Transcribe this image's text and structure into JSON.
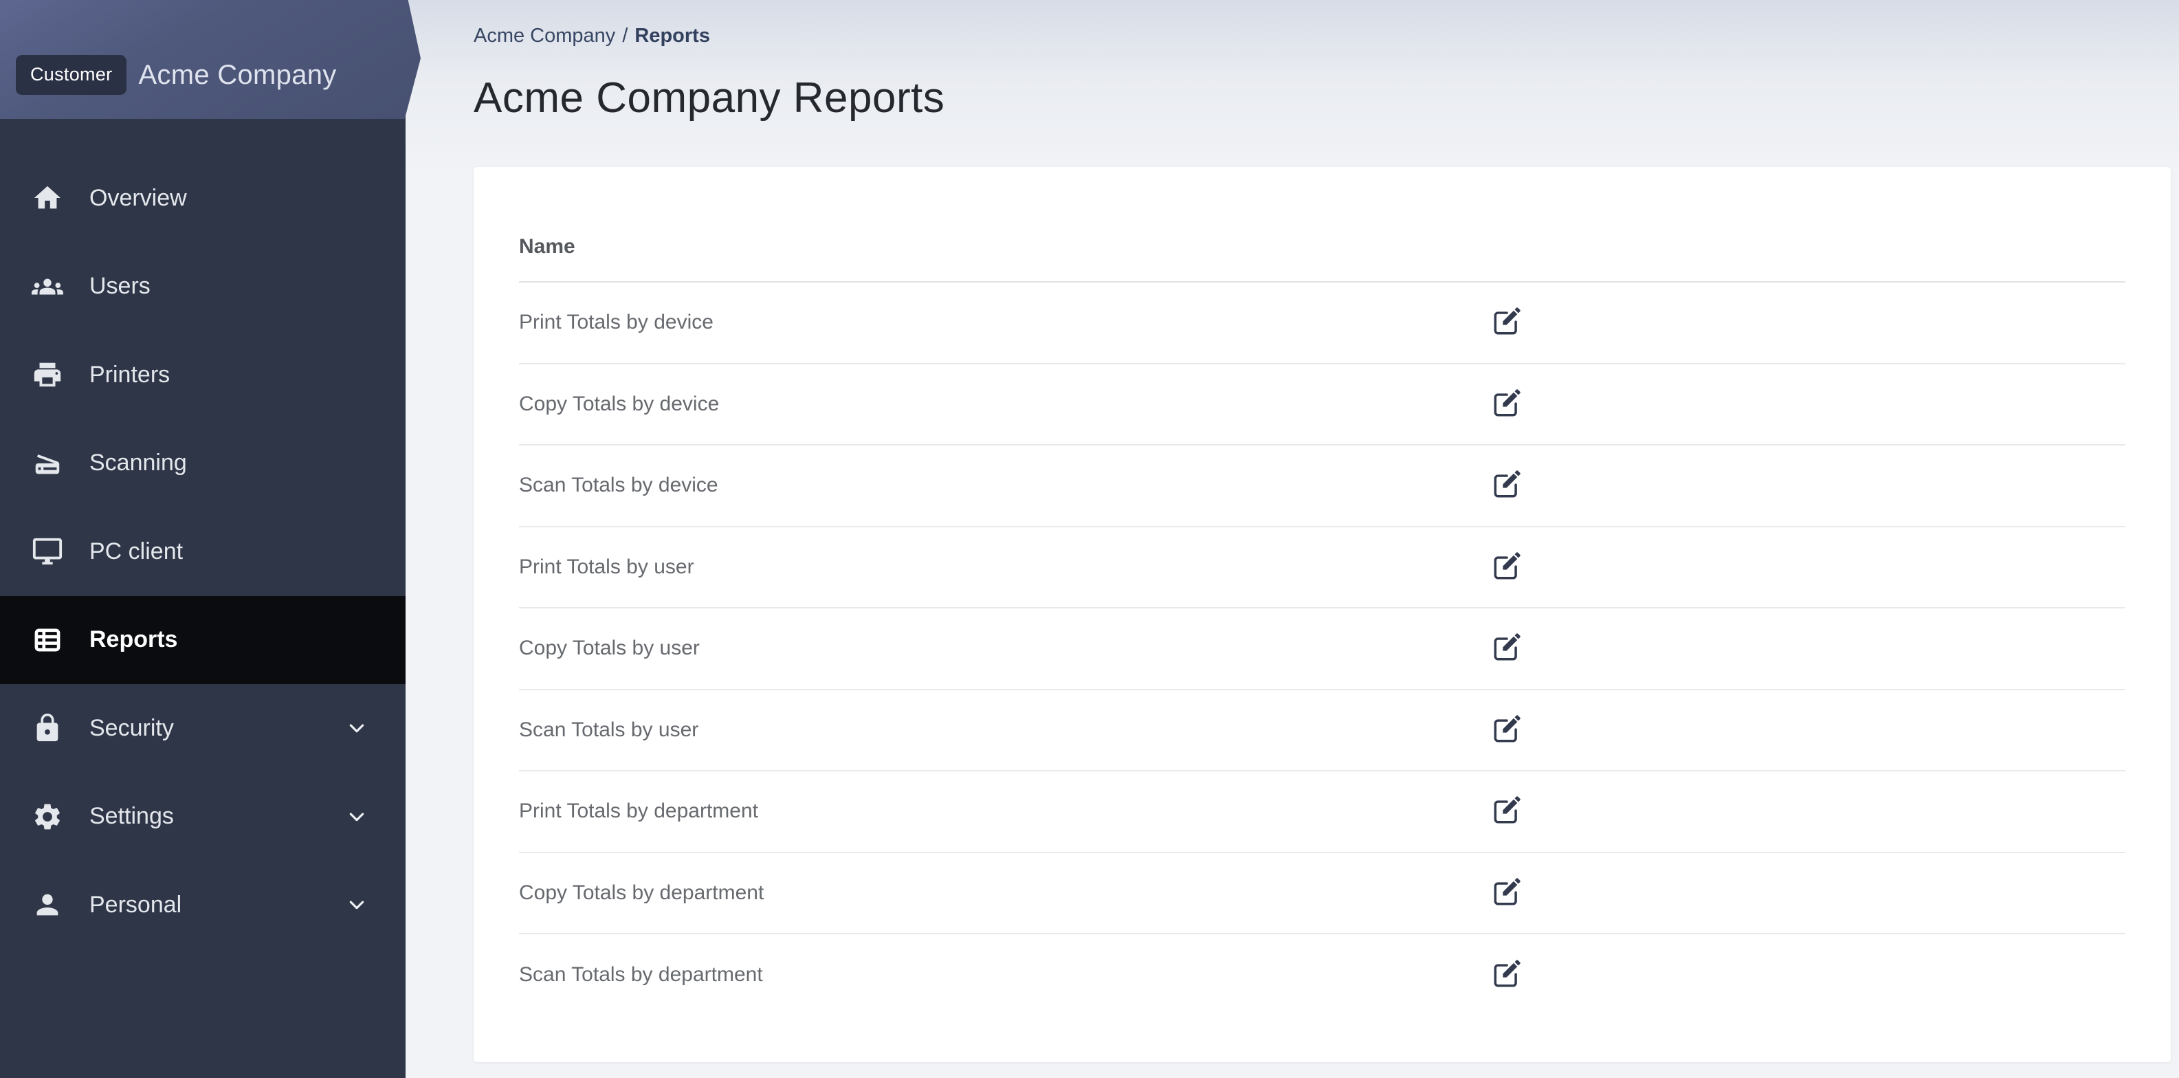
{
  "sidebar": {
    "badge": "Customer",
    "company": "Acme Company",
    "items": [
      {
        "label": "Overview",
        "icon": "home-icon",
        "selected": false,
        "expandable": false
      },
      {
        "label": "Users",
        "icon": "users-icon",
        "selected": false,
        "expandable": false
      },
      {
        "label": "Printers",
        "icon": "printer-icon",
        "selected": false,
        "expandable": false
      },
      {
        "label": "Scanning",
        "icon": "scanner-icon",
        "selected": false,
        "expandable": false
      },
      {
        "label": "PC client",
        "icon": "desktop-icon",
        "selected": false,
        "expandable": false
      },
      {
        "label": "Reports",
        "icon": "reports-icon",
        "selected": true,
        "expandable": false
      },
      {
        "label": "Security",
        "icon": "lock-icon",
        "selected": false,
        "expandable": true
      },
      {
        "label": "Settings",
        "icon": "gear-icon",
        "selected": false,
        "expandable": true
      },
      {
        "label": "Personal",
        "icon": "person-icon",
        "selected": false,
        "expandable": true
      }
    ]
  },
  "breadcrumb": {
    "parent": "Acme Company",
    "separator": "/",
    "current": "Reports"
  },
  "page": {
    "title": "Acme Company Reports"
  },
  "table": {
    "columns": [
      "Name"
    ],
    "row_action_icon": "edit-icon",
    "rows": [
      {
        "name": "Print Totals by device"
      },
      {
        "name": "Copy Totals by device"
      },
      {
        "name": "Scan Totals by device"
      },
      {
        "name": "Print Totals by user"
      },
      {
        "name": "Copy Totals by user"
      },
      {
        "name": "Scan Totals by user"
      },
      {
        "name": "Print Totals by department"
      },
      {
        "name": "Copy Totals by department"
      },
      {
        "name": "Scan Totals by department"
      }
    ]
  },
  "colors": {
    "sidebar_bg": "#2f3647",
    "sidebar_selected_bg": "#0a0c10",
    "banner_gradient_start": "#5d6790",
    "banner_gradient_end": "#475070",
    "badge_bg": "#2b3144",
    "main_bg_top": "#d7dce7",
    "main_bg": "#f1f3f6",
    "card_bg": "#ffffff",
    "divider": "#e8e9eb",
    "row_text": "#66696e",
    "title_text": "#25282e",
    "breadcrumb_text": "#374663",
    "icon_dark": "#333a4d"
  }
}
